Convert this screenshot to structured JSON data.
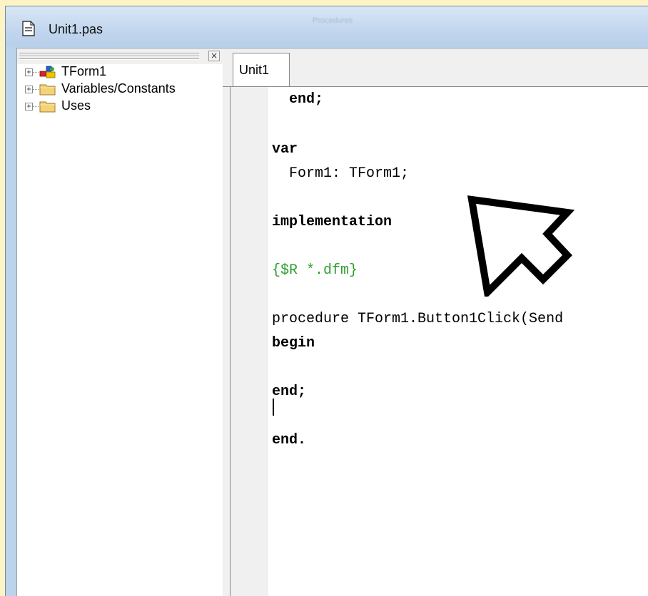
{
  "window": {
    "title": "Unit1.pas",
    "ghost_caption": "Procedures"
  },
  "icons": {
    "title": "document-icon",
    "close": "close-icon",
    "form": "form-icon",
    "folder": "folder-icon",
    "cursor": "cursor-arrow-icon"
  },
  "tree_panel": {
    "close_glyph": "×",
    "items": [
      {
        "label": "TForm1",
        "expander": "+"
      },
      {
        "label": "Variables/Constants",
        "expander": "+"
      },
      {
        "label": "Uses",
        "expander": "+"
      }
    ]
  },
  "editor": {
    "tabs": [
      {
        "label": "Unit1"
      }
    ],
    "lines": [
      "  end;",
      "",
      "var",
      "  Form1: TForm1;",
      "",
      "implementation",
      "",
      "{$R *.dfm}",
      "",
      "procedure TForm1.Button1Click(Send",
      "begin",
      "",
      "end;",
      "",
      "end."
    ]
  },
  "colors": {
    "background": "#fdf3c4",
    "frame": "#bcd3ec",
    "directive": "#2e9e2e"
  }
}
